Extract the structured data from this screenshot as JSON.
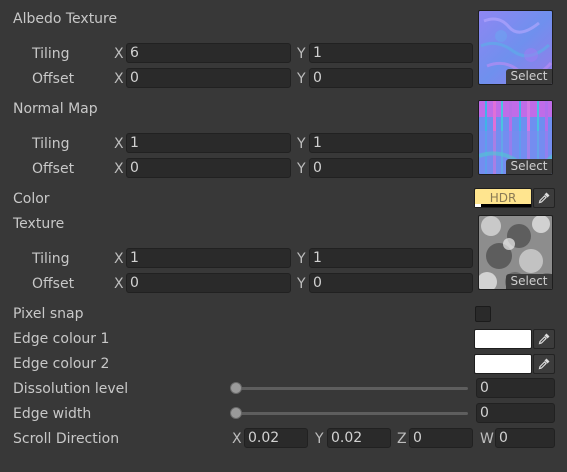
{
  "select_label": "Select",
  "axes": {
    "x": "X",
    "y": "Y",
    "z": "Z",
    "w": "W"
  },
  "albedo": {
    "title": "Albedo Texture",
    "tiling_label": "Tiling",
    "offset_label": "Offset",
    "tiling_x": "6",
    "tiling_y": "1",
    "offset_x": "0",
    "offset_y": "0"
  },
  "normal": {
    "title": "Normal Map",
    "tiling_label": "Tiling",
    "offset_label": "Offset",
    "tiling_x": "1",
    "tiling_y": "1",
    "offset_x": "0",
    "offset_y": "0"
  },
  "color": {
    "label": "Color",
    "hdr_text": "HDR",
    "value": "#ffe58f"
  },
  "texture": {
    "title": "Texture",
    "tiling_label": "Tiling",
    "offset_label": "Offset",
    "tiling_x": "1",
    "tiling_y": "1",
    "offset_x": "0",
    "offset_y": "0"
  },
  "pixel_snap": {
    "label": "Pixel snap",
    "checked": false
  },
  "edge_colour_1": {
    "label": "Edge colour 1",
    "value": "#ffffff"
  },
  "edge_colour_2": {
    "label": "Edge colour 2",
    "value": "#ffffff"
  },
  "dissolution": {
    "label": "Dissolution level",
    "value": "0",
    "fraction": 0
  },
  "edge_width": {
    "label": "Edge width",
    "value": "0",
    "fraction": 0
  },
  "scroll_direction": {
    "label": "Scroll Direction",
    "x": "0.02",
    "y": "0.02",
    "z": "0",
    "w": "0"
  }
}
